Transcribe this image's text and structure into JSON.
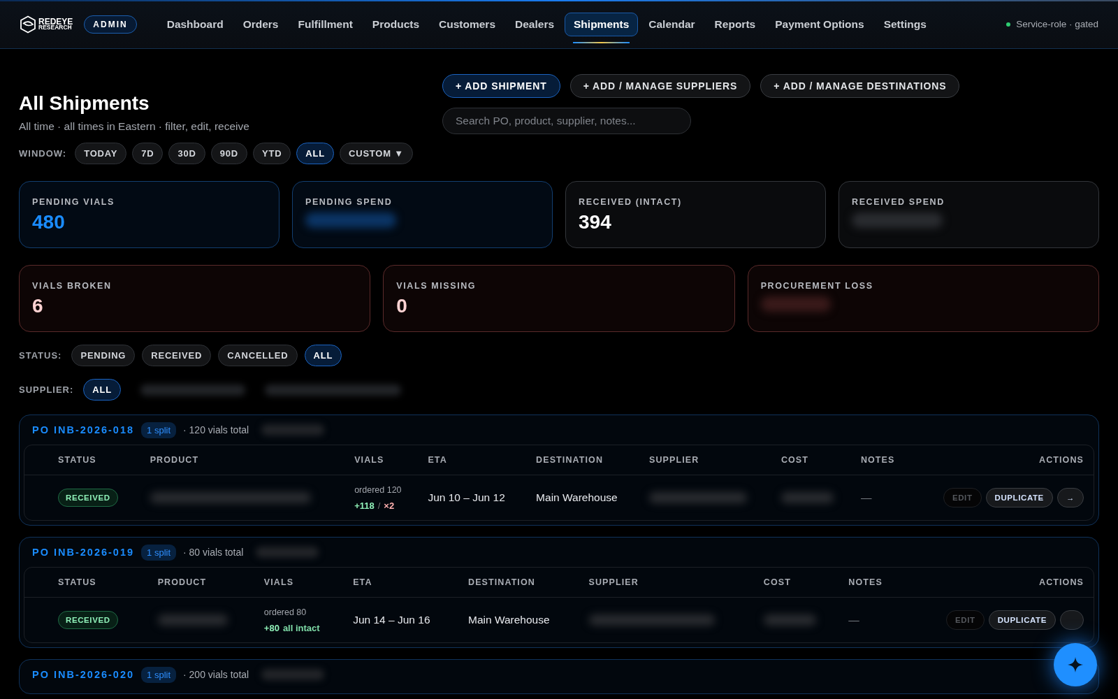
{
  "nav": {
    "brand_top": "REDEYE",
    "brand_bottom": "RESEARCH",
    "role_badge": "ADMIN",
    "items": [
      {
        "label": "Dashboard",
        "selected": false
      },
      {
        "label": "Orders",
        "selected": false
      },
      {
        "label": "Fulfillment",
        "selected": false
      },
      {
        "label": "Products",
        "selected": false
      },
      {
        "label": "Customers",
        "selected": false
      },
      {
        "label": "Dealers",
        "selected": false
      },
      {
        "label": "Shipments",
        "selected": true
      },
      {
        "label": "Calendar",
        "selected": false
      },
      {
        "label": "Reports",
        "selected": false
      },
      {
        "label": "Payment Options",
        "selected": false
      },
      {
        "label": "Settings",
        "selected": false
      }
    ],
    "status": {
      "label": "Service-role · gated",
      "color": "#2ecc71"
    }
  },
  "header": {
    "title": "All Shipments",
    "subtitle": "All time · all times in Eastern · filter, edit, receive",
    "actions": [
      {
        "label": "+ ADD SHIPMENT",
        "kind": "primary"
      },
      {
        "label": "+ ADD / MANAGE SUPPLIERS",
        "kind": "secondary"
      },
      {
        "label": "+ ADD / MANAGE DESTINATIONS",
        "kind": "secondary"
      }
    ],
    "search": {
      "placeholder": "Search PO, product, supplier, notes..."
    },
    "window": {
      "label": "WINDOW:",
      "options": [
        {
          "label": "TODAY",
          "selected": false
        },
        {
          "label": "7D",
          "selected": false
        },
        {
          "label": "30D",
          "selected": false
        },
        {
          "label": "90D",
          "selected": false
        },
        {
          "label": "YTD",
          "selected": false
        },
        {
          "label": "ALL",
          "selected": true
        },
        {
          "label": "CUSTOM ▼",
          "selected": false
        }
      ]
    }
  },
  "kpis": [
    [
      {
        "label": "PENDING VIALS",
        "value": "480",
        "kind": "pending"
      },
      {
        "label": "PENDING SPEND",
        "blurred": true,
        "kind": "pending"
      },
      {
        "label": "RECEIVED (INTACT)",
        "value": "394",
        "kind": "received"
      },
      {
        "label": "RECEIVED SPEND",
        "blurred": true,
        "kind": "received"
      }
    ],
    [
      {
        "label": "VIALS BROKEN",
        "value": "6",
        "kind": "loss"
      },
      {
        "label": "VIALS MISSING",
        "value": "0",
        "kind": "loss"
      },
      {
        "label": "PROCUREMENT LOSS",
        "blurred": true,
        "kind": "loss"
      }
    ]
  ],
  "status_filter": {
    "label": "STATUS:",
    "options": [
      {
        "label": "PENDING",
        "selected": false
      },
      {
        "label": "RECEIVED",
        "selected": false
      },
      {
        "label": "CANCELLED",
        "selected": false
      },
      {
        "label": "ALL",
        "selected": true
      }
    ]
  },
  "supplier_filter": {
    "label": "SUPPLIER:",
    "options": [
      {
        "label": "ALL",
        "selected": true
      },
      {
        "blurred": true,
        "selected": false
      },
      {
        "blurred": true,
        "selected": false
      }
    ]
  },
  "groups": [
    {
      "po": "PO INB-2026-018",
      "split": "1 split",
      "total": "· 120 vials total",
      "blurred_extra": true,
      "columns": [
        "STATUS",
        "PRODUCT",
        "VIALS",
        "ETA",
        "DESTINATION",
        "SUPPLIER",
        "COST",
        "NOTES",
        "ACTIONS"
      ],
      "rows": [
        {
          "status": "RECEIVED",
          "kind": "received",
          "ordered": "ordered 120",
          "vials": [
            {
              "text": "+118",
              "kind": "good"
            },
            {
              "text": "/",
              "kind": "sep"
            },
            {
              "text": "×2",
              "kind": "bad"
            }
          ],
          "eta": "Jun 10 – Jun 12",
          "destination": "Main Warehouse",
          "notes": "—",
          "actions": [
            {
              "label": "EDIT",
              "disabled": true
            },
            {
              "label": "DUPLICATE",
              "disabled": false
            },
            {
              "label": "→",
              "disabled": false
            }
          ]
        }
      ]
    },
    {
      "po": "PO INB-2026-019",
      "split": "1 split",
      "total": "· 80 vials total",
      "blurred_extra": true,
      "columns": [
        "STATUS",
        "PRODUCT",
        "VIALS",
        "ETA",
        "DESTINATION",
        "SUPPLIER",
        "COST",
        "NOTES",
        "ACTIONS"
      ],
      "rows": [
        {
          "status": "RECEIVED",
          "kind": "received",
          "ordered": "ordered 80",
          "vials": [
            {
              "text": "+80",
              "kind": "good"
            },
            {
              "text": "all intact",
              "kind": "note"
            }
          ],
          "eta": "Jun 14 – Jun 16",
          "destination": "Main Warehouse",
          "notes": "—",
          "actions": [
            {
              "label": "EDIT",
              "disabled": true
            },
            {
              "label": "DUPLICATE",
              "disabled": false
            },
            {
              "disabled": false
            }
          ]
        }
      ]
    },
    {
      "po": "PO INB-2026-020",
      "split": "1 split",
      "total": "· 200 vials total",
      "blurred_extra": true
    }
  ]
}
